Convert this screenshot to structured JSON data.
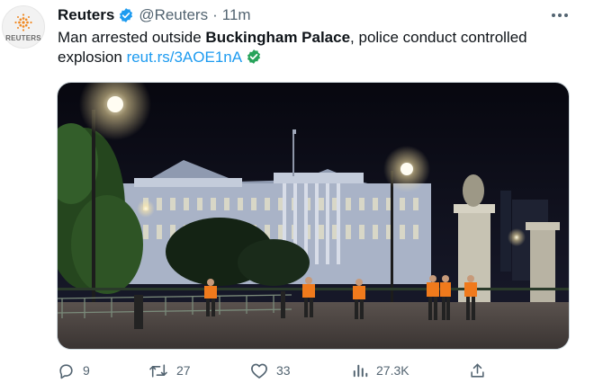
{
  "author": {
    "name": "Reuters",
    "handle": "@Reuters",
    "separator": "·",
    "time": "11m",
    "avatar_text": "REUTERS",
    "verified_icon": "verified-badge-icon"
  },
  "tweet": {
    "text_before": "Man arrested outside ",
    "text_bold": "Buckingham Palace",
    "text_after": ", police conduct controlled explosion ",
    "link": "reut.rs/3AOE1nA"
  },
  "media": {
    "description_icon": "photo",
    "colors": {
      "sky": "#0c0d1a",
      "palace": "#b7c0d2",
      "ground": "#4a4442",
      "vest": "#f07a1c"
    }
  },
  "actions": {
    "replies": "9",
    "retweets": "27",
    "likes": "33",
    "views": "27.3K"
  },
  "colors": {
    "accent": "#1d9bf0",
    "muted": "#536471",
    "text": "#0f1419",
    "verified_check": "#27a35a"
  }
}
